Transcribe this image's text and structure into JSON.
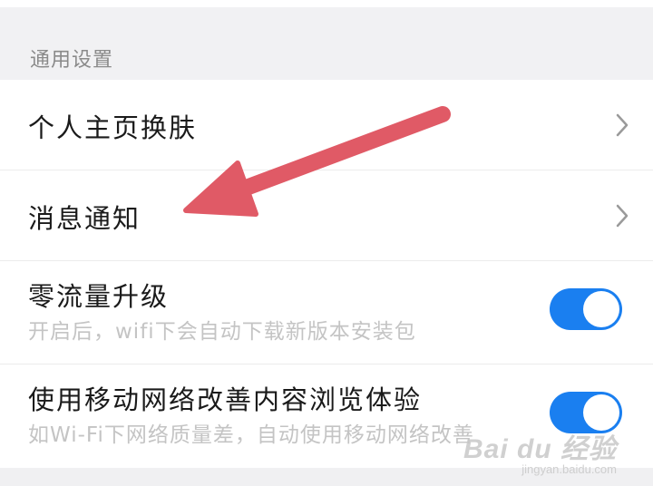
{
  "section": {
    "title": "通用设置"
  },
  "items": [
    {
      "label": "个人主页换肤",
      "icon": "chevron-right-icon"
    },
    {
      "label": "消息通知",
      "icon": "chevron-right-icon"
    },
    {
      "label": "零流量升级",
      "sublabel": "开启后，wifi下会自动下载新版本安装包",
      "toggle_on": true
    },
    {
      "label": "使用移动网络改善内容浏览体验",
      "sublabel": "如Wi-Fi下网络质量差，自动使用移动网络改善",
      "toggle_on": true
    }
  ],
  "colors": {
    "toggle_on": "#1a7ff0",
    "annotation_arrow": "#e05a66",
    "background": "#f0f0f2"
  },
  "watermark": {
    "logo": "Bai du 经验",
    "url": "jingyan.baidu.com"
  }
}
